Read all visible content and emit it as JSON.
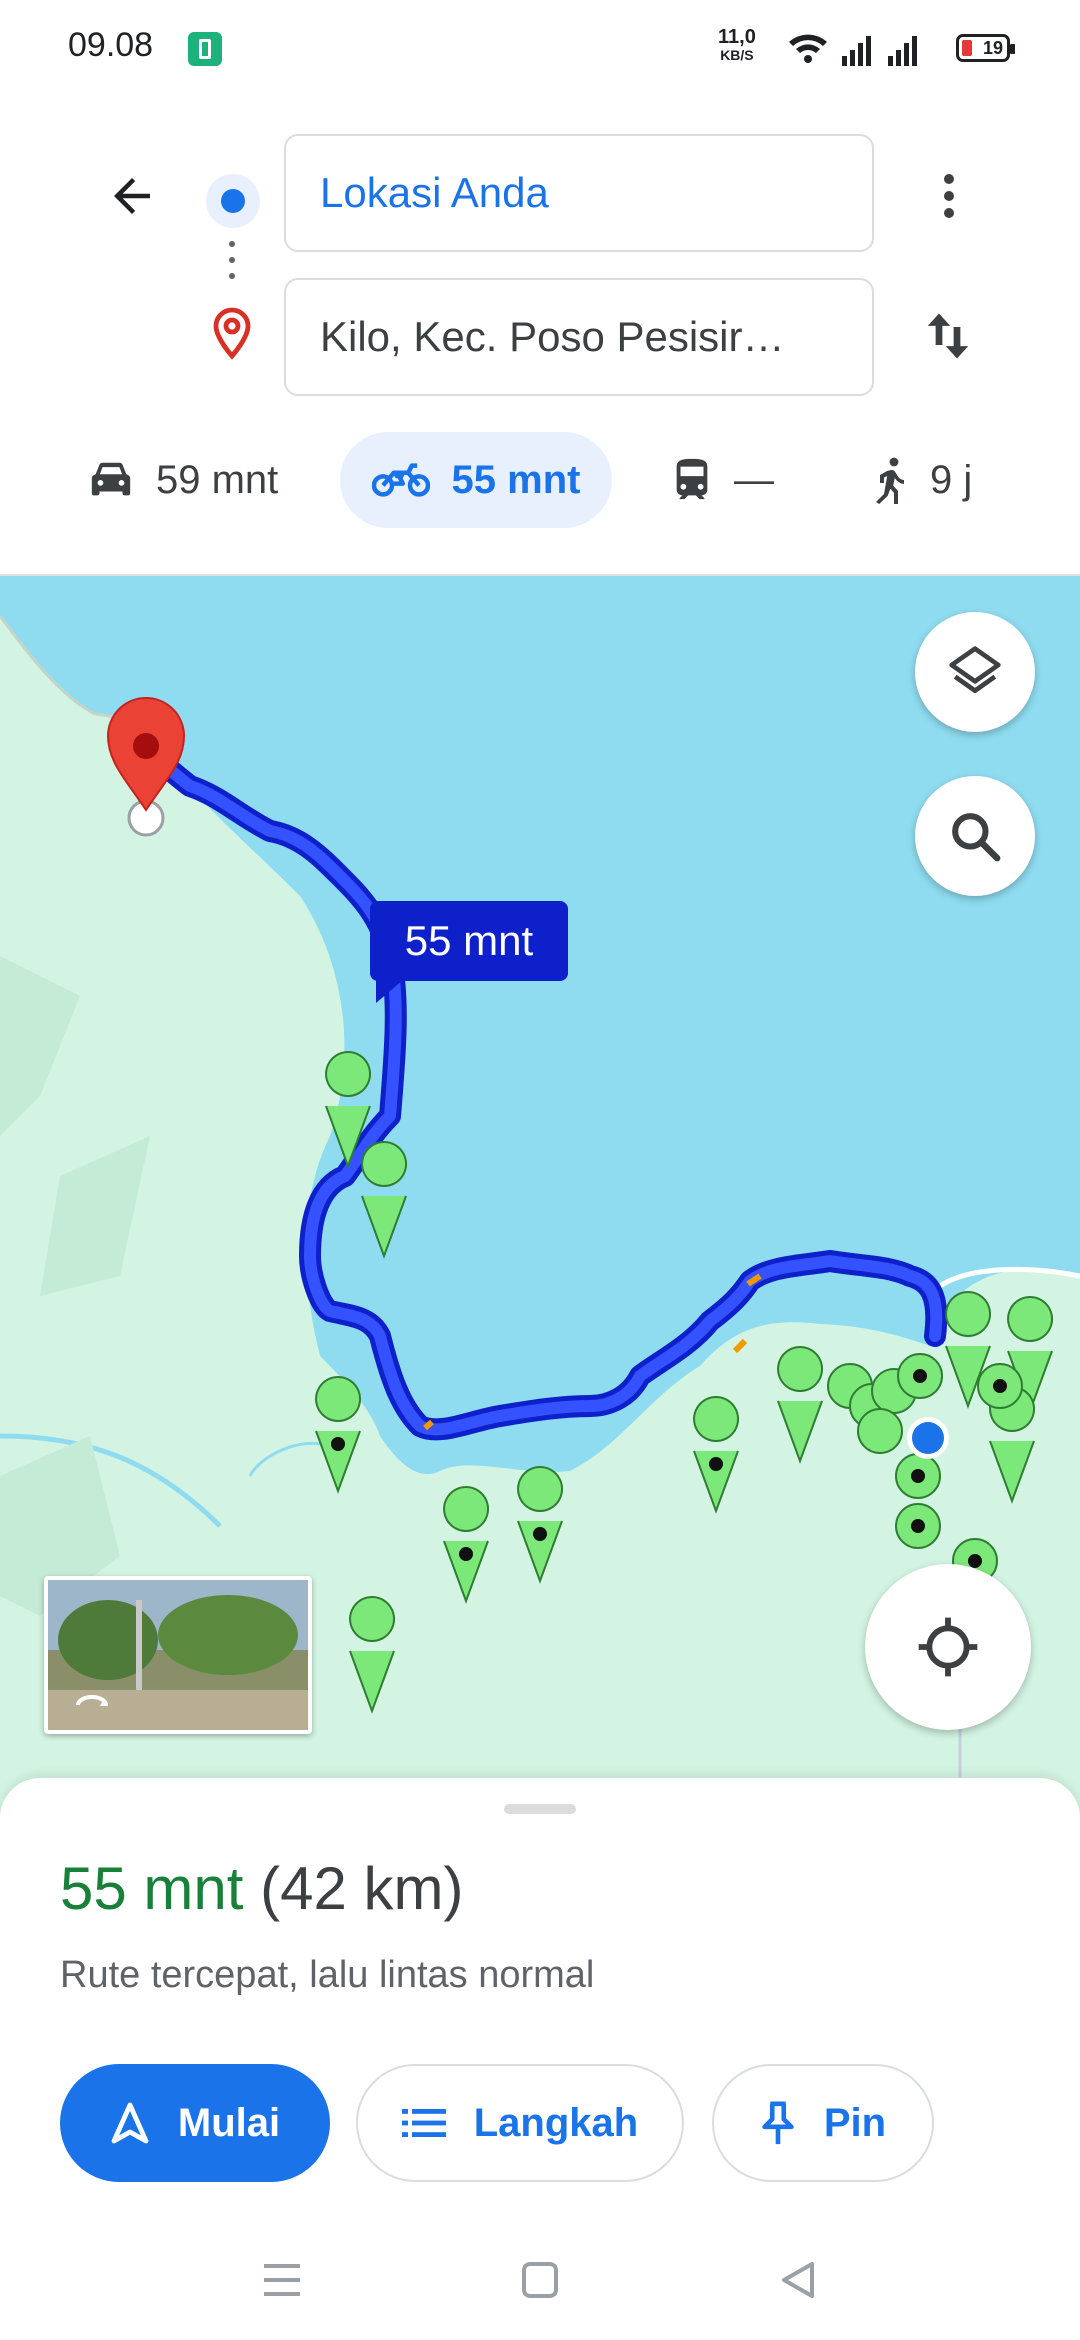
{
  "status_bar": {
    "time": "09.08",
    "net_speed_value": "11,0",
    "net_speed_unit": "KB/S",
    "battery_level": "19"
  },
  "directions": {
    "origin": "Lokasi Anda",
    "destination": "Kilo, Kec. Poso Pesisir…"
  },
  "modes": [
    {
      "icon": "car-icon",
      "label": "59 mnt"
    },
    {
      "icon": "motorcycle-icon",
      "label": "55 mnt",
      "selected": true
    },
    {
      "icon": "transit-icon",
      "label": "—"
    },
    {
      "icon": "walk-icon",
      "label": "9 j"
    }
  ],
  "map": {
    "route_label": "55 mnt"
  },
  "sheet": {
    "duration": "55 mnt",
    "distance": "(42 km)",
    "description": "Rute tercepat, lalu lintas normal",
    "start_label": "Mulai",
    "steps_label": "Langkah",
    "pin_label": "Pin"
  },
  "colors": {
    "accent": "#1a73e8",
    "route": "#1a3de8",
    "water": "#8fdcf0",
    "land": "#d3f4e2",
    "duration_green": "#188038"
  }
}
